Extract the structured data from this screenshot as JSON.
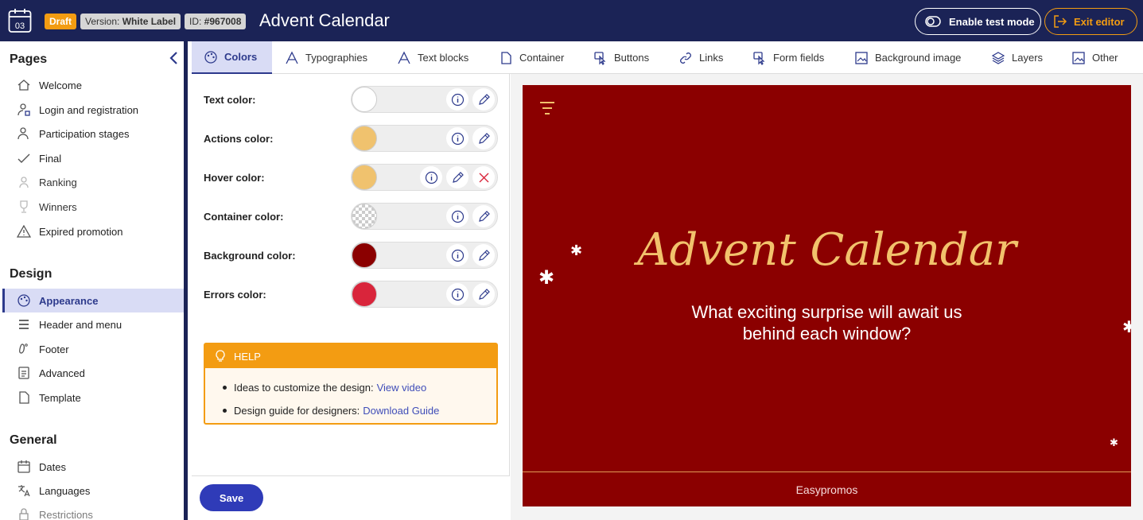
{
  "header": {
    "calendar_day": "03",
    "draft": "Draft",
    "version_prefix": "Version: ",
    "version_value": "White Label",
    "id_prefix": "ID: ",
    "id_value": "#967008",
    "title": "Advent Calendar",
    "test_mode": "Enable test mode",
    "exit": "Exit editor"
  },
  "sidebar": {
    "pages_title": "Pages",
    "pages": [
      "Welcome",
      "Login and registration",
      "Participation stages",
      "Final",
      "Ranking",
      "Winners",
      "Expired promotion"
    ],
    "design_title": "Design",
    "design": [
      "Appearance",
      "Header and menu",
      "Footer",
      "Advanced",
      "Template"
    ],
    "general_title": "General",
    "general": [
      "Dates",
      "Languages",
      "Restrictions"
    ]
  },
  "tabs": [
    "Colors",
    "Typographies",
    "Text blocks",
    "Container",
    "Buttons",
    "Links",
    "Form fields",
    "Background image",
    "Layers",
    "Other"
  ],
  "colors": [
    {
      "label": "Text color:",
      "value": "#ffffff"
    },
    {
      "label": "Actions color:",
      "value": "#f0c26e"
    },
    {
      "label": "Hover color:",
      "value": "#f0c26e"
    },
    {
      "label": "Container color:",
      "value": "transparent"
    },
    {
      "label": "Background color:",
      "value": "#8b0000"
    },
    {
      "label": "Errors color:",
      "value": "#d9253b"
    }
  ],
  "help": {
    "title": "HELP",
    "item1_text": "Ideas to customize the design:",
    "item1_link": "View video",
    "item2_text": "Design guide for designers:",
    "item2_link": "Download Guide"
  },
  "save": "Save",
  "preview": {
    "title": "Advent Calendar",
    "subtitle": "What exciting surprise will await us behind each window?",
    "footer": "Easypromos"
  },
  "theme": {
    "navy": "#1b2356",
    "accent": "#f39c12",
    "primary": "#2f3bb8",
    "preview_bg": "#8b0000",
    "preview_title": "#f2c26c"
  }
}
